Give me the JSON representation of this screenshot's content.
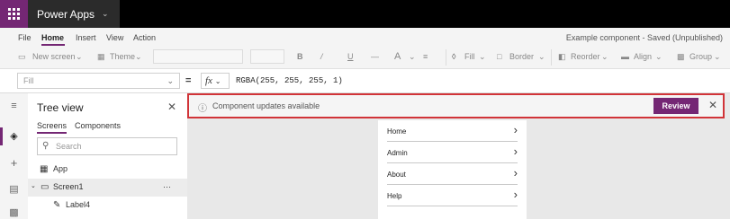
{
  "app": {
    "name": "Power Apps"
  },
  "menu": {
    "items": [
      "File",
      "Home",
      "Insert",
      "View",
      "Action"
    ],
    "active": "Home"
  },
  "status_text": "Example component - Saved (Unpublished)",
  "toolbar": {
    "new_screen": "New screen",
    "theme": "Theme",
    "fill": "Fill",
    "border": "Border",
    "reorder": "Reorder",
    "align": "Align",
    "group": "Group"
  },
  "formula_bar": {
    "property": "Fill",
    "equals": "=",
    "fx": "fx",
    "formula": "RGBA(255, 255, 255, 1)"
  },
  "tree_view": {
    "title": "Tree view",
    "tabs": [
      "Screens",
      "Components"
    ],
    "active_tab": "Screens",
    "search_placeholder": "Search",
    "items": [
      {
        "label": "App"
      },
      {
        "label": "Screen1",
        "more": "···"
      },
      {
        "label": "Label4"
      }
    ]
  },
  "banner": {
    "message": "Component updates available",
    "button": "Review"
  },
  "component_menu": {
    "items": [
      "Home",
      "Admin",
      "About",
      "Help"
    ]
  },
  "accent_color": "#742774",
  "alert_border_color": "#d13438"
}
